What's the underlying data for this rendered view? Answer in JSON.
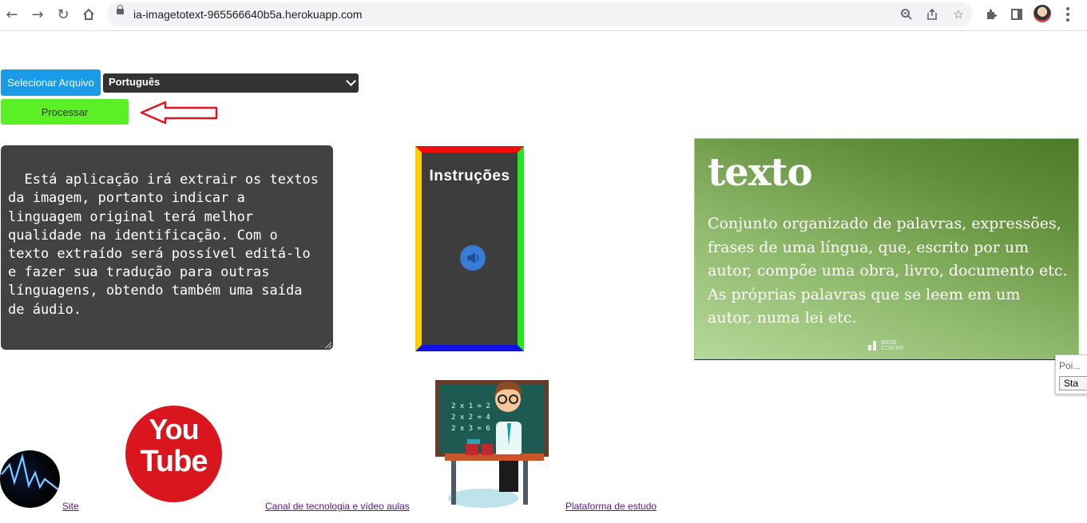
{
  "browser": {
    "url": "ia-imagetotext-965566640b5a.herokuapp.com"
  },
  "controls": {
    "select_file_label": "Selecionar Arquivo",
    "language_selected": "Português",
    "process_label": "Processar"
  },
  "description_text": "Está aplicação irá extrair os textos da imagem, portanto indicar a linguagem original terá melhor qualidade na identificação. Com o texto extraído será possível editá-lo e fazer sua tradução para outras línguagens, obtendo também uma saída de áudio.",
  "instructions": {
    "title": "Instruções"
  },
  "definition_card": {
    "word": "texto",
    "definition": "Conjunto organizado de palavras, expressões, frases de uma língua, que, escrito por um autor, compõe uma obra, livro, documento etc. As próprias palavras que se leem em um autor, numa lei etc.",
    "watermark_line1": "DICIO",
    "watermark_line2": "COM.BR"
  },
  "popup": {
    "placeholder": "Poi...",
    "button": "Sta"
  },
  "youtube_logo": {
    "line1": "You",
    "line2": "Tube"
  },
  "teacher_board_lines": [
    "2 x 1 = 2",
    "2 x 2 = 4",
    "2 x 3 = 6"
  ],
  "links": {
    "site": "Site",
    "channel": "Canal de tecnologia e vídeo aulas",
    "platform": "Plataforma de estudo"
  },
  "colors": {
    "select_file_button": "#1a9be9",
    "process_button": "#5bef26",
    "arrow": "#e0141e",
    "text_box": "#424242",
    "instr_top": "#f50a0a",
    "instr_right": "#1ee81e",
    "instr_bottom": "#1212e8",
    "instr_left": "#ffcc00",
    "youtube_red": "#d9161d"
  },
  "icons": [
    "back-arrow-icon",
    "forward-arrow-icon",
    "reload-icon",
    "home-icon",
    "lock-icon",
    "zoom-icon",
    "share-icon",
    "star-icon",
    "extensions-icon",
    "side-panel-icon",
    "profile-avatar",
    "menu-icon",
    "speaker-icon"
  ]
}
